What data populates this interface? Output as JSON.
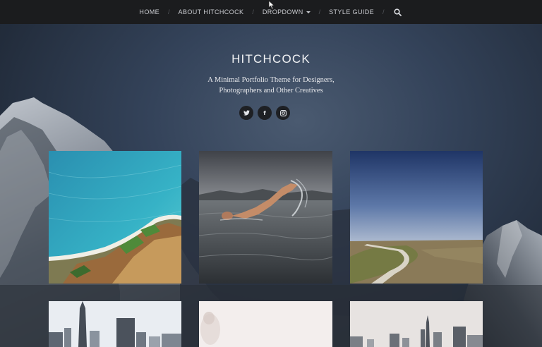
{
  "nav": {
    "items": [
      {
        "label": "HOME"
      },
      {
        "label": "ABOUT HITCHCOCK"
      },
      {
        "label": "DROPDOWN"
      },
      {
        "label": "STYLE GUIDE"
      }
    ],
    "search_icon": "search-icon"
  },
  "site": {
    "title": "HITCHCOCK",
    "description_line1": "A Minimal Portfolio Theme for Designers,",
    "description_line2": "Photographers and Other Creatives"
  },
  "social": [
    {
      "icon": "twitter-icon",
      "glyph": "🐦"
    },
    {
      "icon": "facebook-icon",
      "glyph": "f"
    },
    {
      "icon": "instagram-icon",
      "glyph": "◎"
    }
  ],
  "portfolio": [
    {
      "subject": "aerial coastline"
    },
    {
      "subject": "swimmer in sea"
    },
    {
      "subject": "country road"
    },
    {
      "subject": "city skyline towers"
    },
    {
      "subject": "hazy figure"
    },
    {
      "subject": "city skyline"
    }
  ],
  "colors": {
    "nav_bg": "#1b1c1e",
    "hero_bg": "#34435a",
    "text": "#f2f3f5"
  }
}
